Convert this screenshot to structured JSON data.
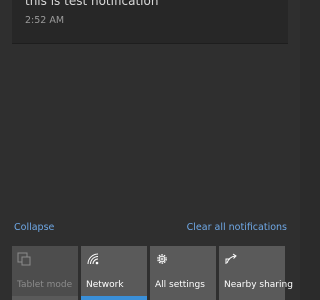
{
  "notification": {
    "message": "this is test notification",
    "time": "2:52 AM"
  },
  "actions": {
    "collapse_label": "Collapse",
    "clear_label": "Clear all notifications"
  },
  "quick_actions": [
    {
      "label": "Tablet mode",
      "icon": "tablet-mode-icon",
      "enabled": false
    },
    {
      "label": "Network",
      "icon": "network-icon",
      "enabled": true
    },
    {
      "label": "All settings",
      "icon": "gear-icon",
      "enabled": true
    },
    {
      "label": "Nearby sharing",
      "icon": "share-icon",
      "enabled": true
    }
  ],
  "colors": {
    "link": "#6fa8e6",
    "tile": "#5a5a5a",
    "tile_disabled": "#4d4d4d",
    "accent": "#3a8fd8"
  }
}
